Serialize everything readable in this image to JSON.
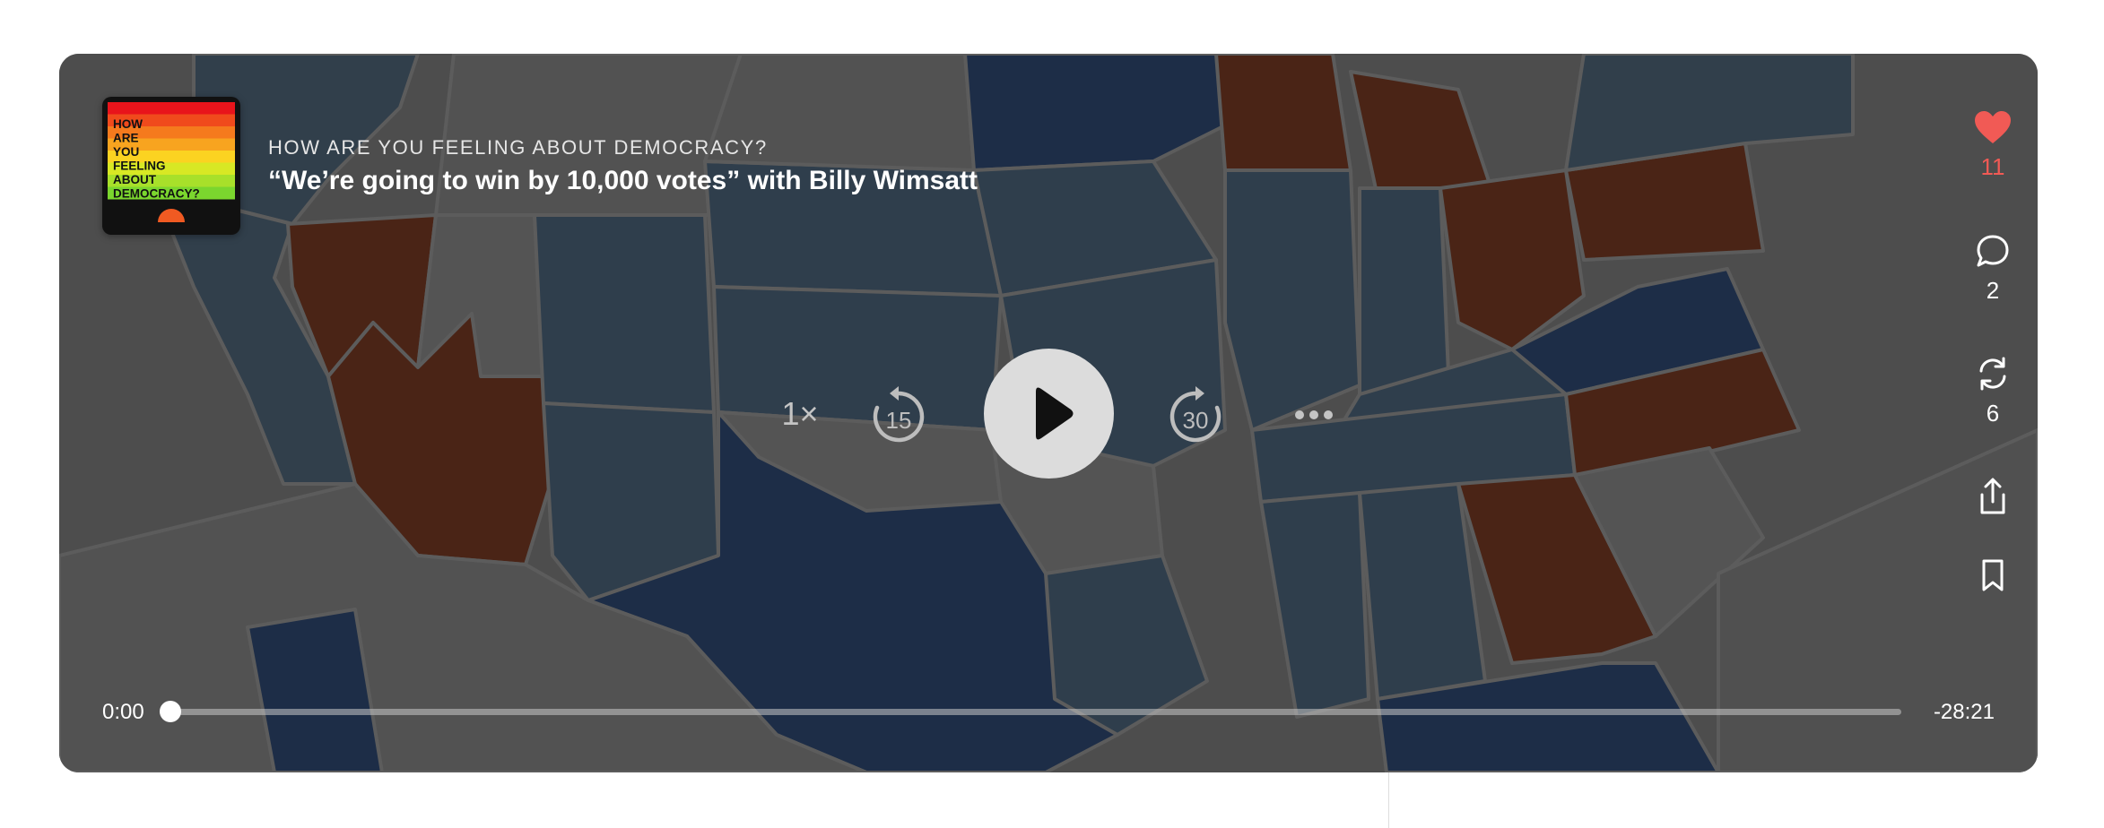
{
  "podcast": {
    "show_name": "HOW ARE YOU FEELING ABOUT DEMOCRACY?",
    "episode_title": "“We’re going to win by 10,000 votes” with Billy Wimsatt",
    "artwork": {
      "lines": [
        "HOW",
        "ARE",
        "YOU",
        "FEELING",
        "ABOUT",
        "DEMOCRACY?"
      ],
      "stripe_colors": [
        "#e8141b",
        "#f04a1c",
        "#f57a1d",
        "#f8a41f",
        "#fbd321",
        "#d8e824",
        "#a8e02a",
        "#7bd62e"
      ]
    }
  },
  "controls": {
    "speed_label": "1×",
    "skip_back_seconds": "15",
    "skip_forward_seconds": "30"
  },
  "progress": {
    "elapsed": "0:00",
    "remaining": "-28:21",
    "fraction": 0.0
  },
  "actions": {
    "likes": "11",
    "comments": "2",
    "restacks": "6"
  },
  "colors": {
    "like": "#f15a55",
    "background": "#555555",
    "blue_state": "#13294b",
    "red_state": "#4f1c0a",
    "light_blue_state": "#2b3f52"
  }
}
